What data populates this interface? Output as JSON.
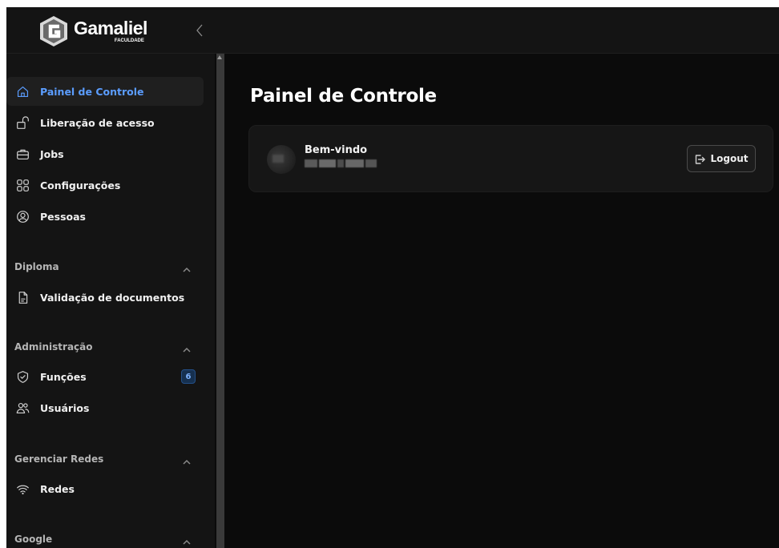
{
  "brand": {
    "name": "Gamaliel",
    "subtitle": "FACULDADE"
  },
  "sidebar": {
    "collapse_icon": "chevron-left-icon",
    "items": [
      {
        "label": "Painel de Controle",
        "icon": "home-icon",
        "active": true
      },
      {
        "label": "Liberação de acesso",
        "icon": "unlock-icon"
      },
      {
        "label": "Jobs",
        "icon": "briefcase-icon"
      },
      {
        "label": "Configurações",
        "icon": "grid-icon"
      },
      {
        "label": "Pessoas",
        "icon": "user-circle-icon"
      }
    ],
    "sections": [
      {
        "title": "Diploma",
        "items": [
          {
            "label": "Validação de documentos",
            "icon": "document-icon"
          }
        ]
      },
      {
        "title": "Administração",
        "items": [
          {
            "label": "Funções",
            "icon": "shield-check-icon",
            "badge": "6"
          },
          {
            "label": "Usuários",
            "icon": "users-icon"
          }
        ]
      },
      {
        "title": "Gerenciar Redes",
        "items": [
          {
            "label": "Redes",
            "icon": "wifi-icon"
          }
        ]
      },
      {
        "title": "Google",
        "items": []
      }
    ]
  },
  "main": {
    "title": "Painel de Controle",
    "card": {
      "welcome": "Bem-vindo",
      "logout_label": "Logout"
    }
  },
  "colors": {
    "accent": "#5b9dff",
    "background": "#0b0b0b",
    "sidebar": "#141414",
    "card": "#161616"
  }
}
